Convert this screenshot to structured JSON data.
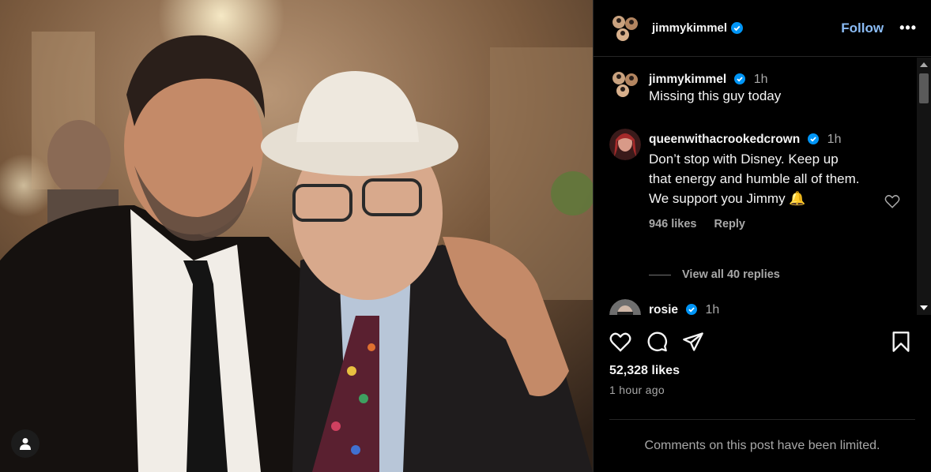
{
  "post": {
    "username": "jimmykimmel",
    "follow_label": "Follow",
    "more_label": "•••",
    "caption": {
      "username": "jimmykimmel",
      "time": "1h",
      "text": "Missing this guy today"
    },
    "comments": [
      {
        "username": "queenwithacrookedcrown",
        "time": "1h",
        "text": "Don’t stop with Disney. Keep up that energy and humble all of them. We support you Jimmy 🔔",
        "likes": "946 likes",
        "reply_label": "Reply",
        "view_replies": "View all 40 replies"
      },
      {
        "username": "rosie",
        "time": "1h"
      }
    ],
    "likes": "52,328 likes",
    "time_ago": "1 hour ago",
    "comments_limited": "Comments on this post have been limited."
  },
  "icons": {
    "like": "heart-icon",
    "comment": "comment-icon",
    "share": "share-icon",
    "save": "bookmark-icon",
    "user_tag": "user-icon",
    "verified": "verified-badge-icon"
  },
  "colors": {
    "background": "#000000",
    "verified": "#0095f6",
    "follow": "#8bbcf5",
    "secondary_text": "#a8a8a8"
  }
}
